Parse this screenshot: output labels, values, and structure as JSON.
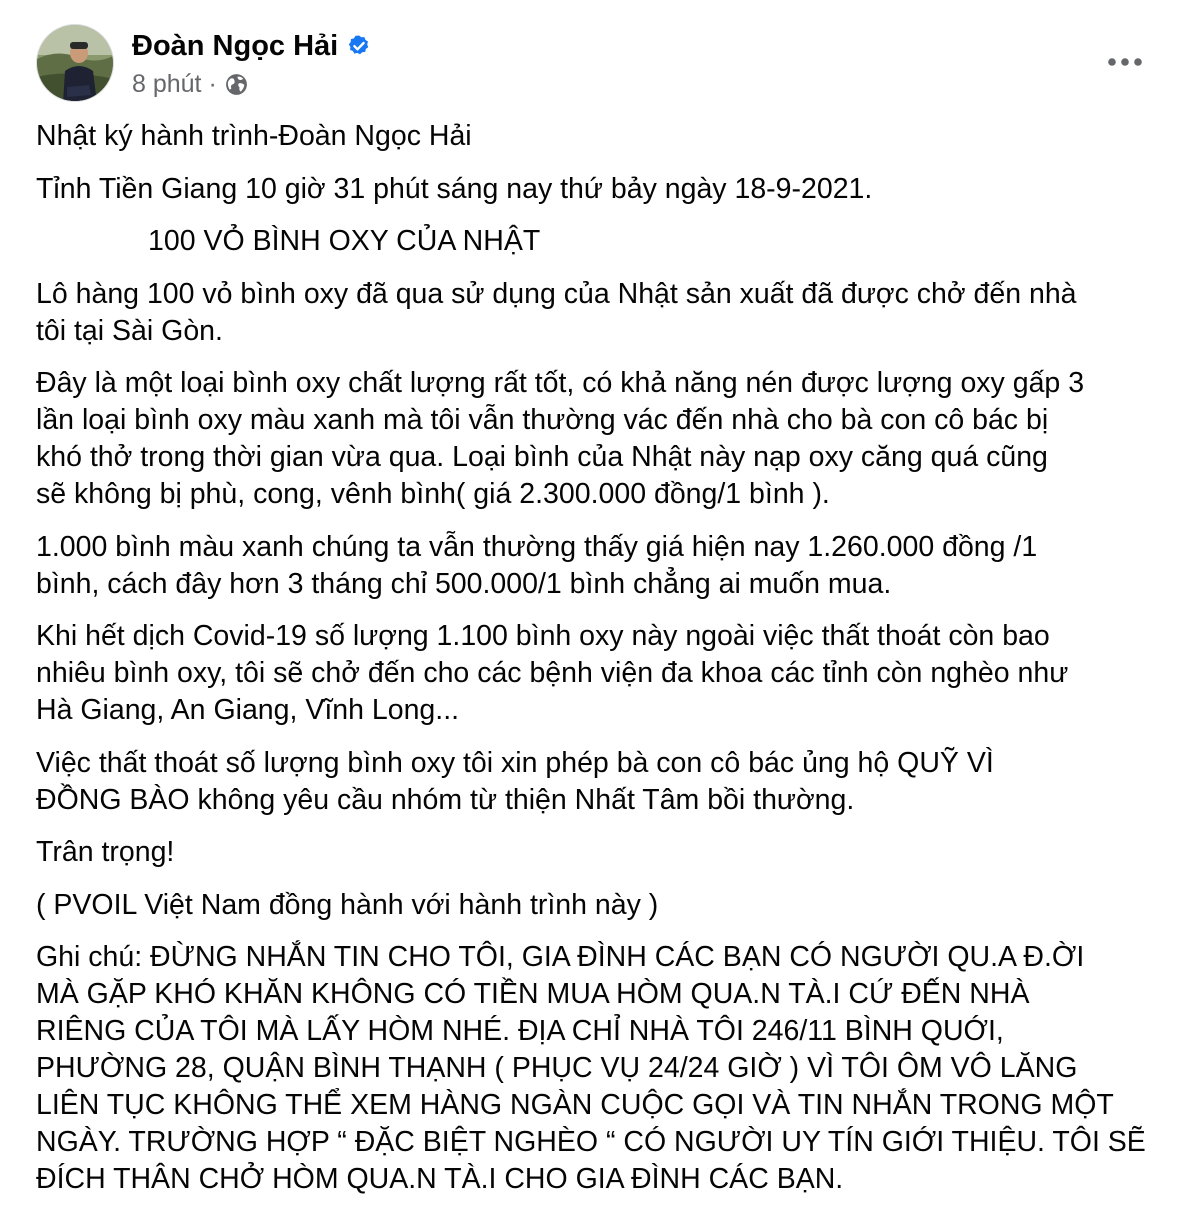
{
  "post": {
    "author": {
      "name": "Đoàn Ngọc Hải",
      "verified": true,
      "avatar_icon": "author-avatar-photo"
    },
    "meta": {
      "timestamp": "8 phút",
      "separator": "·",
      "audience_icon": "globe-icon"
    },
    "more_icon": "more-options-icon",
    "colors": {
      "text": "#050505",
      "secondary_text": "#65676b",
      "verified_badge": "#1877f2"
    },
    "paragraphs": [
      "Nhật ký hành trình-Đoàn Ngọc Hải",
      "Tỉnh Tiền Giang 10 giờ 31 phút sáng nay thứ bảy ngày 18-9-2021.",
      "100 VỎ BÌNH OXY CỦA NHẬT",
      "Lô hàng 100 vỏ bình oxy đã qua sử dụng của Nhật sản xuất đã được chở đến nhà\ntôi tại Sài Gòn.",
      "Đây là một loại bình oxy chất lượng rất tốt, có khả năng nén được lượng oxy gấp 3\nlần loại bình oxy màu xanh mà tôi vẫn thường vác đến nhà cho bà con cô bác bị\nkhó thở trong thời gian vừa qua. Loại bình của Nhật này nạp oxy căng quá cũng\nsẽ không bị phù, cong, vênh bình( giá 2.300.000 đồng/1 bình ).",
      "1.000 bình màu xanh chúng ta vẫn thường thấy giá hiện nay 1.260.000 đồng /1\nbình, cách đây hơn 3 tháng chỉ 500.000/1 bình chẳng ai muốn mua.",
      "Khi hết dịch Covid-19 số lượng 1.100 bình oxy này ngoài việc thất thoát còn bao\nnhiêu bình oxy, tôi sẽ chở đến cho các bệnh viện đa khoa các tỉnh còn nghèo như\nHà Giang, An Giang, Vĩnh Long...",
      "Việc thất thoát số lượng bình oxy tôi xin phép bà con cô bác ủng hộ QUỸ VÌ\nĐỒNG BÀO không yêu cầu nhóm từ thiện Nhất Tâm bồi thường.",
      "Trân trọng!",
      "( PVOIL Việt Nam đồng hành với hành trình này )",
      "Ghi chú: ĐỪNG NHẮN TIN CHO TÔI, GIA ĐÌNH CÁC BẠN CÓ NGƯỜI QU.A Đ.ỜI\nMÀ GẶP KHÓ KHĂN KHÔNG CÓ TIỀN MUA HÒM QUA.N TÀ.I CỨ ĐẾN NHÀ\nRIÊNG CỦA TÔI MÀ LẤY HÒM NHÉ. ĐỊA CHỈ NHÀ TÔI 246/11 BÌNH QUỚI,\nPHƯỜNG 28, QUẬN BÌNH THẠNH ( PHỤC VỤ 24/24 GIỜ ) VÌ TÔI ÔM VÔ LĂNG\nLIÊN TỤC KHÔNG THỂ XEM HÀNG NGÀN CUỘC GỌI VÀ TIN NHẮN TRONG MỘT\nNGÀY. TRƯỜNG HỢP “ ĐẶC BIỆT NGHÈO “ CÓ NGƯỜI UY TÍN GIỚI THIỆU. TÔI SẼ\nĐÍCH THÂN CHỞ HÒM QUA.N TÀ.I CHO GIA ĐÌNH CÁC BẠN."
    ]
  }
}
